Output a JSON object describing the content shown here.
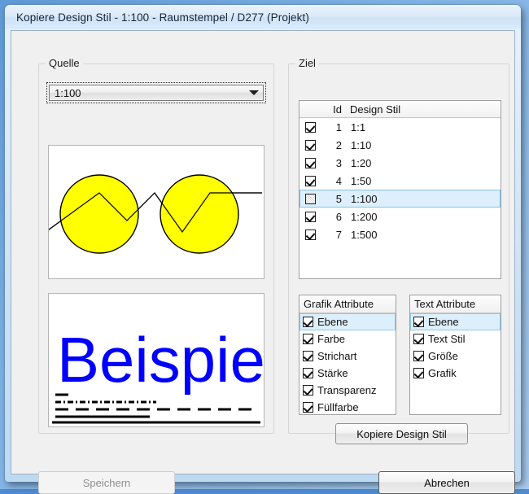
{
  "window": {
    "title": "Kopiere Design Stil  -  1:100  -  Raumstempel / D277 (Projekt)"
  },
  "source": {
    "group_label": "Quelle",
    "scale_combo": {
      "value": "1:100",
      "arrow_icon": "chevron-down-icon"
    },
    "graphic_preview": {
      "shapes": "two-yellow-circles-with-zigzag-polyline",
      "fill_color": "#FFFF00",
      "stroke_color": "#000000"
    },
    "text_preview": {
      "sample_text": "Beispiel",
      "text_color": "#0000FF",
      "line_samples": [
        "short-solid",
        "fine-dash-dot",
        "dashed",
        "medium-solid",
        "thick-solid"
      ]
    }
  },
  "target": {
    "group_label": "Ziel",
    "columns": [
      "Id",
      "Design Stil"
    ],
    "rows": [
      {
        "checked": true,
        "id": "1",
        "name": "1:1",
        "selected": false
      },
      {
        "checked": true,
        "id": "2",
        "name": "1:10",
        "selected": false
      },
      {
        "checked": true,
        "id": "3",
        "name": "1:20",
        "selected": false
      },
      {
        "checked": true,
        "id": "4",
        "name": "1:50",
        "selected": false
      },
      {
        "checked": false,
        "id": "5",
        "name": "1:100",
        "selected": true
      },
      {
        "checked": true,
        "id": "6",
        "name": "1:200",
        "selected": false
      },
      {
        "checked": true,
        "id": "7",
        "name": "1:500",
        "selected": false
      }
    ]
  },
  "graphic_attributes": {
    "header": "Grafik Attribute",
    "items": [
      {
        "label": "Ebene",
        "checked": true,
        "selected": true
      },
      {
        "label": "Farbe",
        "checked": true,
        "selected": false
      },
      {
        "label": "Strichart",
        "checked": true,
        "selected": false
      },
      {
        "label": "Stärke",
        "checked": true,
        "selected": false
      },
      {
        "label": "Transparenz",
        "checked": true,
        "selected": false
      },
      {
        "label": "Füllfarbe",
        "checked": true,
        "selected": false
      }
    ]
  },
  "text_attributes": {
    "header": "Text Attribute",
    "items": [
      {
        "label": "Ebene",
        "checked": true,
        "selected": true
      },
      {
        "label": "Text Stil",
        "checked": true,
        "selected": false
      },
      {
        "label": "Größe",
        "checked": true,
        "selected": false
      },
      {
        "label": "Grafik",
        "checked": true,
        "selected": false
      }
    ]
  },
  "buttons": {
    "copy_style": {
      "label": "Kopiere Design Stil",
      "enabled": true,
      "default": false
    },
    "save": {
      "label": "Speichern",
      "enabled": false,
      "default": false
    },
    "cancel": {
      "label": "Abrechen",
      "enabled": true,
      "default": true
    }
  },
  "colors": {
    "accent_selection": "#ddeffc",
    "preview_yellow": "#FFFF00",
    "preview_blue": "#0000FF",
    "dialog_face": "#f0f0f0"
  }
}
